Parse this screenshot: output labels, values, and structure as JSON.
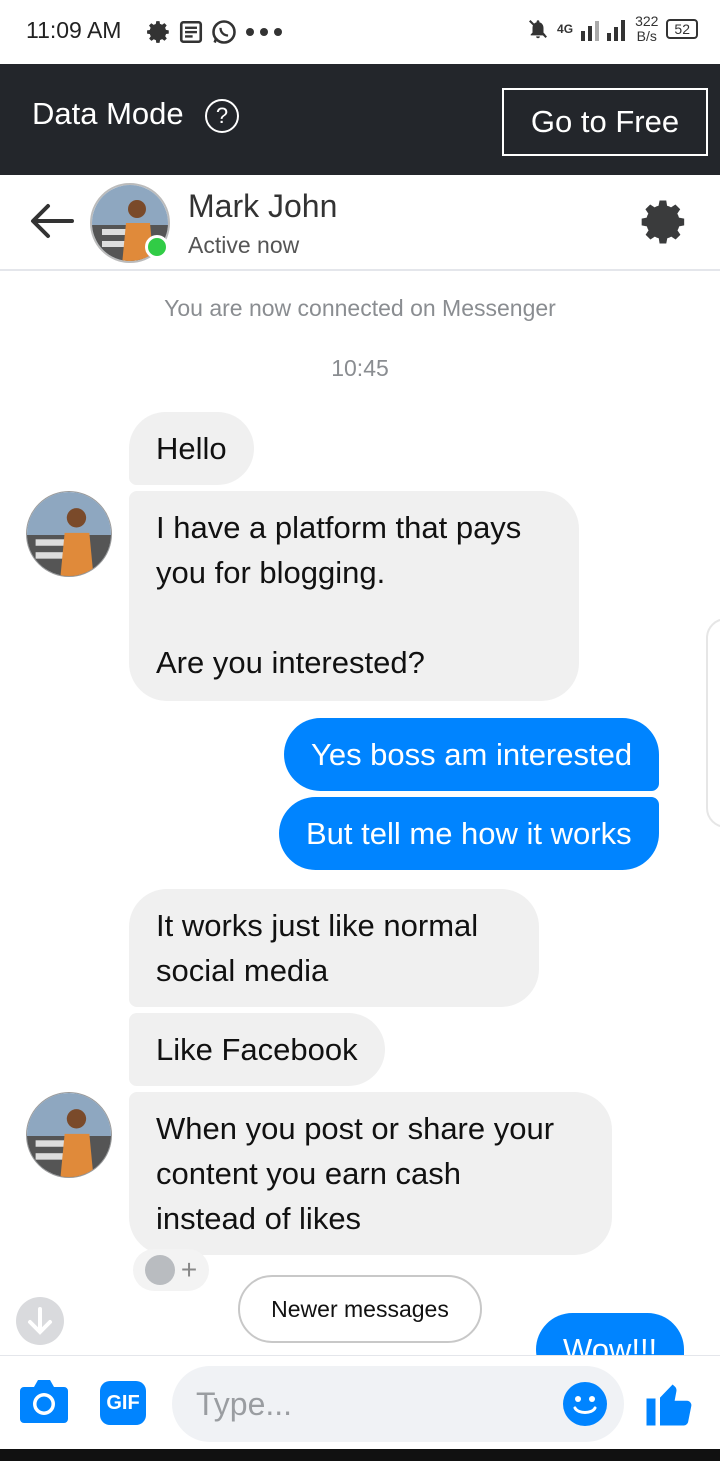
{
  "status_bar": {
    "time": "11:09 AM",
    "network": "4G",
    "speed_value": "322",
    "speed_unit": "B/s",
    "battery": "52"
  },
  "banner": {
    "text": "Data Mode",
    "help": "?",
    "button": "Go to Free"
  },
  "header": {
    "name": "Mark John",
    "status": "Active now"
  },
  "messages": {
    "system_note": "You are now connected on Messenger",
    "timestamp": "10:45",
    "m1": "Hello",
    "m2_l1": "I have a platform that pays",
    "m2_l2": "you for blogging.",
    "m2_l3": "Are you interested?",
    "m3": "Yes boss am interested",
    "m4": "But tell me how it works",
    "m5_l1": "It works just like normal",
    "m5_l2": "social media",
    "m6": "Like Facebook",
    "m7_l1": "When you post or share your",
    "m7_l2": "content you earn cash",
    "m7_l3": "instead of likes",
    "m8": "Wow!!!"
  },
  "newer_messages": "Newer messages",
  "composer": {
    "gif": "GIF",
    "placeholder": "Type..."
  },
  "colors": {
    "accent": "#0084ff",
    "banner_bg": "#23262b",
    "incoming_bubble": "#f0f0f0",
    "online": "#31cc46"
  },
  "icons": [
    "back-arrow-icon",
    "settings-gear-icon",
    "camera-icon",
    "smile-icon",
    "thumbs-up-icon",
    "arrow-down-icon",
    "help-icon"
  ]
}
